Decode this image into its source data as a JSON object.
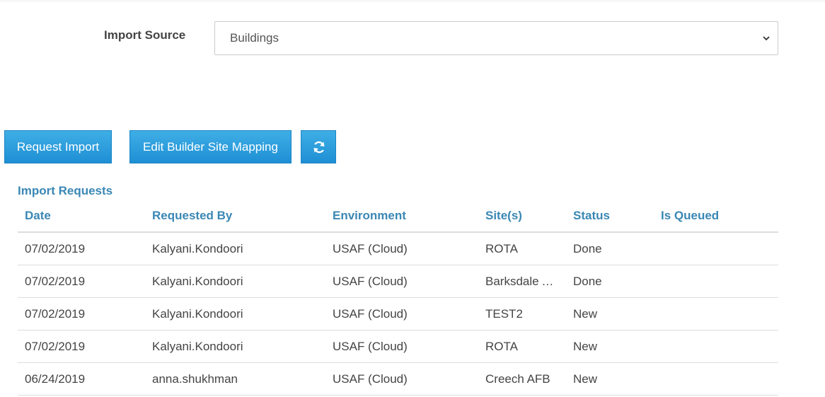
{
  "form": {
    "import_source_label": "Import Source",
    "import_source_value": "Buildings"
  },
  "toolbar": {
    "request_import_label": "Request Import",
    "edit_mapping_label": "Edit Builder Site Mapping",
    "refresh_icon": "refresh-icon"
  },
  "requests": {
    "title": "Import Requests",
    "columns": [
      "Date",
      "Requested By",
      "Environment",
      "Site(s)",
      "Status",
      "Is Queued"
    ],
    "rows": [
      {
        "date": "07/02/2019",
        "requested_by": "Kalyani.Kondoori",
        "environment": "USAF (Cloud)",
        "sites": "ROTA",
        "status": "Done",
        "is_queued": ""
      },
      {
        "date": "07/02/2019",
        "requested_by": "Kalyani.Kondoori",
        "environment": "USAF (Cloud)",
        "sites": "Barksdale AFB",
        "status": "Done",
        "is_queued": ""
      },
      {
        "date": "07/02/2019",
        "requested_by": "Kalyani.Kondoori",
        "environment": "USAF (Cloud)",
        "sites": "TEST2",
        "status": "New",
        "is_queued": ""
      },
      {
        "date": "07/02/2019",
        "requested_by": "Kalyani.Kondoori",
        "environment": "USAF (Cloud)",
        "sites": "ROTA",
        "status": "New",
        "is_queued": ""
      },
      {
        "date": "06/24/2019",
        "requested_by": "anna.shukhman",
        "environment": "USAF (Cloud)",
        "sites": "Creech AFB",
        "status": "New",
        "is_queued": ""
      }
    ]
  },
  "colors": {
    "accent": "#3a87b4",
    "button": "#2a9ddd"
  }
}
